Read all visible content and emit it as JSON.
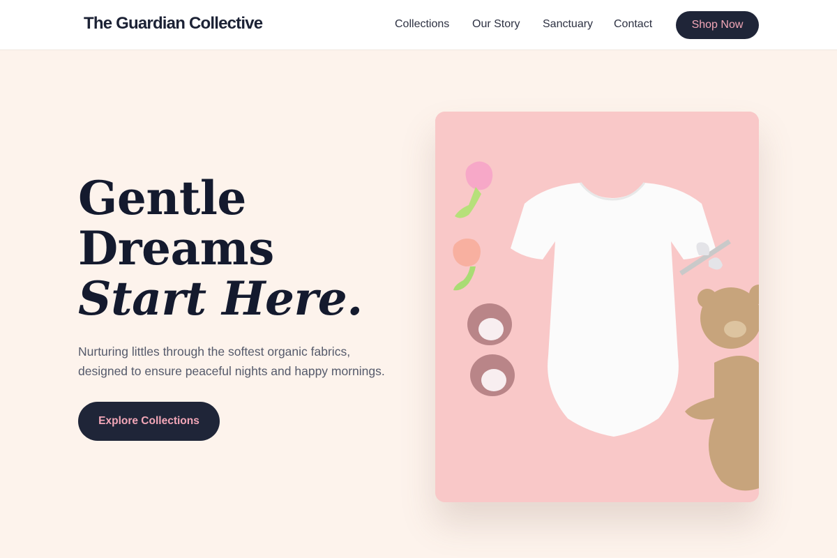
{
  "brand": "The Guardian Collective",
  "nav": {
    "items": [
      "Collections",
      "Our Story",
      "Sanctuary",
      "Contact"
    ],
    "shop_label": "Shop Now"
  },
  "hero": {
    "line1": "Gentle",
    "line2": "Dreams",
    "line3": "Start Here.",
    "subtitle": "Nurturing littles through the softest organic fabrics, designed to ensure peaceful nights and happy mornings.",
    "cta_label": "Explore Collections"
  },
  "colors": {
    "accent": "#1f2538",
    "accent_text": "#f3a7b8",
    "page_bg": "#fdf3ec",
    "photo_bg": "#f9c8c8"
  },
  "image": {
    "subject": "baby-onesie-flatlay"
  }
}
